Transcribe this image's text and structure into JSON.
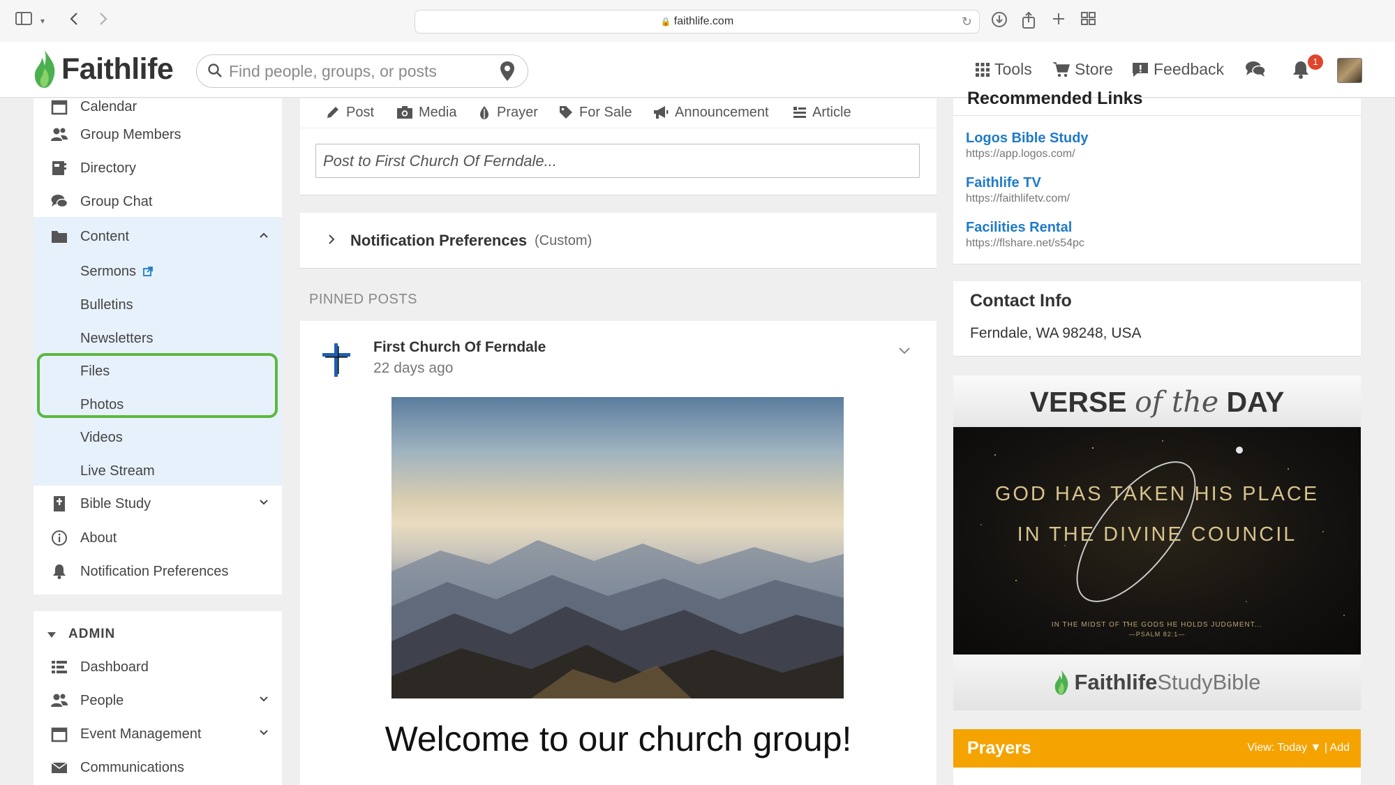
{
  "browser": {
    "url": "faithlife.com"
  },
  "header": {
    "logo_text": "Faithlife",
    "search_placeholder": "Find people, groups, or posts",
    "nav": {
      "tools": "Tools",
      "store": "Store",
      "feedback": "Feedback"
    },
    "notification_count": "1"
  },
  "sidebar": {
    "items": {
      "calendar": "Calendar",
      "group_members": "Group Members",
      "directory": "Directory",
      "group_chat": "Group Chat",
      "content": "Content",
      "sermons": "Sermons",
      "bulletins": "Bulletins",
      "newsletters": "Newsletters",
      "files": "Files",
      "photos": "Photos",
      "videos": "Videos",
      "live_stream": "Live Stream",
      "bible_study": "Bible Study",
      "about": "About",
      "notification_preferences": "Notification Preferences"
    },
    "admin": {
      "title": "ADMIN",
      "dashboard": "Dashboard",
      "people": "People",
      "event_management": "Event Management",
      "communications": "Communications"
    }
  },
  "composer": {
    "types": {
      "post": "Post",
      "media": "Media",
      "prayer": "Prayer",
      "for_sale": "For Sale",
      "announcement": "Announcement",
      "article": "Article"
    },
    "placeholder": "Post to First Church Of Ferndale..."
  },
  "notification_bar": {
    "title": "Notification Preferences",
    "status": "(Custom)"
  },
  "pinned": {
    "label": "PINNED POSTS",
    "post": {
      "author": "First Church Of Ferndale",
      "time": "22 days ago",
      "heading": "Welcome to our church group!"
    }
  },
  "right": {
    "links_title": "Recommended Links",
    "links": [
      {
        "title": "Logos Bible Study",
        "url": "https://app.logos.com/"
      },
      {
        "title": "Faithlife TV",
        "url": "https://faithlifetv.com/"
      },
      {
        "title": "Facilities Rental",
        "url": "https://flshare.net/s54pc"
      }
    ],
    "contact": {
      "title": "Contact Info",
      "address": "Ferndale, WA 98248, USA"
    },
    "votd": {
      "word1": "VERSE",
      "word2": "of the",
      "word3": "DAY",
      "line1": "GOD HAS TAKEN HIS PLACE",
      "line2": "IN THE DIVINE COUNCIL",
      "small1": "IN THE MIDST OF THE GODS HE HOLDS JUDGMENT...",
      "small2": "—PSALM 82:1—",
      "brand1": "Faithlife",
      "brand2": "Study",
      "brand3": "Bible"
    },
    "prayers": {
      "title": "Prayers",
      "view": "View: Today ▼",
      "add": "Add"
    }
  },
  "colors": {
    "accent_blue": "#1f7ac9",
    "highlight_green": "#5cb83f",
    "prayers_orange": "#f5a300",
    "badge_red": "#e0452b",
    "sidebar_active_bg": "#e7f1fb"
  }
}
